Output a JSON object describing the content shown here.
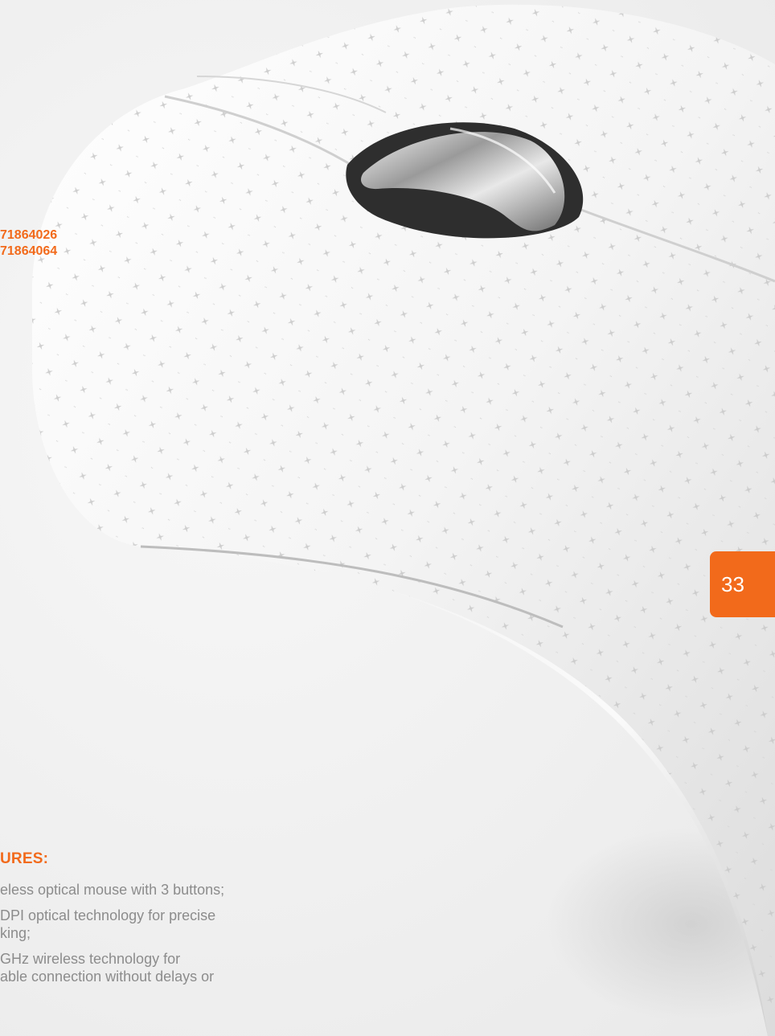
{
  "product_codes": [
    "71864026",
    "71864064"
  ],
  "features": {
    "title": "URES:",
    "items": [
      "eless optical mouse with 3 buttons;",
      " DPI optical technology for precise\nking;",
      "GHz wireless technology for\nable connection without delays or"
    ]
  },
  "page_number": "33",
  "colors": {
    "accent": "#f26a1b",
    "body_text": "#8c8c8c",
    "background": "#f3f3f3"
  }
}
